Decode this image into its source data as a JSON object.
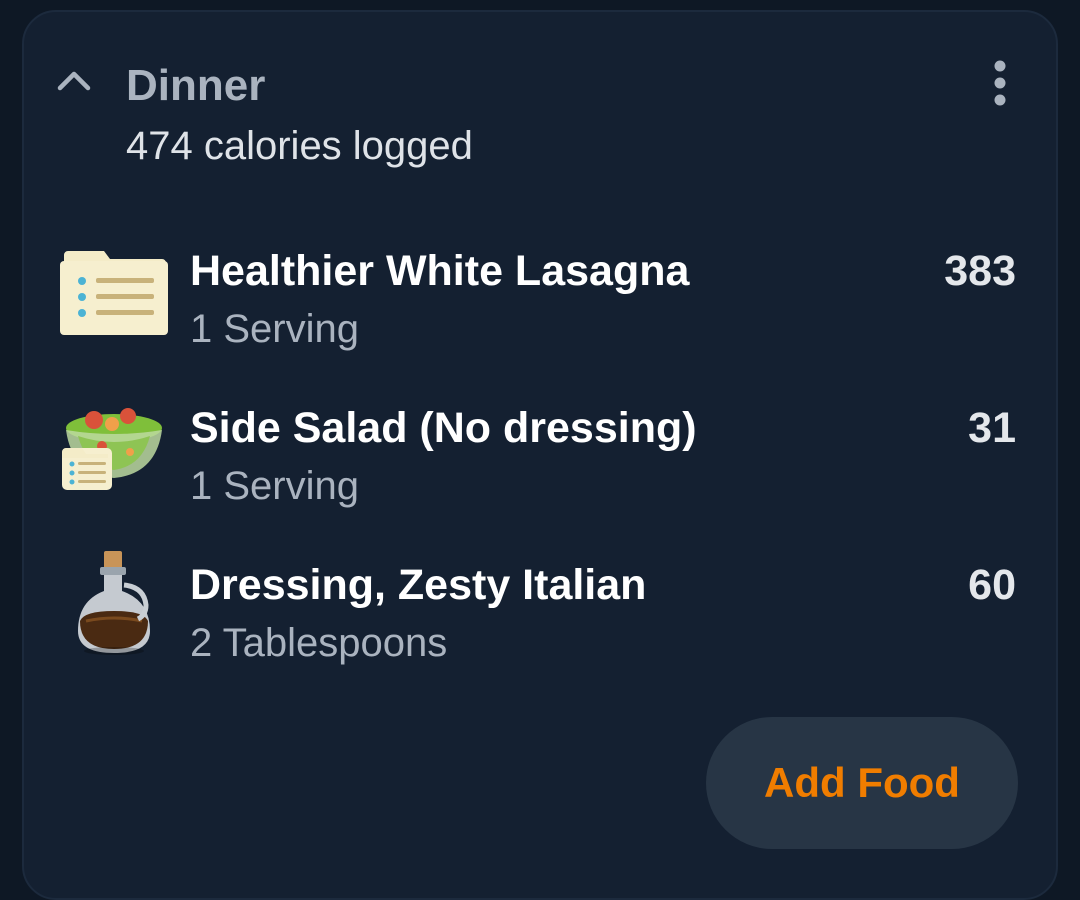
{
  "meal": {
    "title": "Dinner",
    "subtitle": "474 calories logged"
  },
  "items": [
    {
      "name": "Healthier White Lasagna",
      "qty": "1 Serving",
      "calories": "383",
      "icon": "recipe-card-icon"
    },
    {
      "name": "Side Salad (No dressing)",
      "qty": "1 Serving",
      "calories": "31",
      "icon": "salad-bowl-icon"
    },
    {
      "name": "Dressing, Zesty Italian",
      "qty": "2 Tablespoons",
      "calories": "60",
      "icon": "oil-bottle-icon"
    }
  ],
  "actions": {
    "add_food_label": "Add Food"
  },
  "colors": {
    "accent": "#f07d00",
    "card_bg": "#142031",
    "page_bg": "#0e1825"
  }
}
